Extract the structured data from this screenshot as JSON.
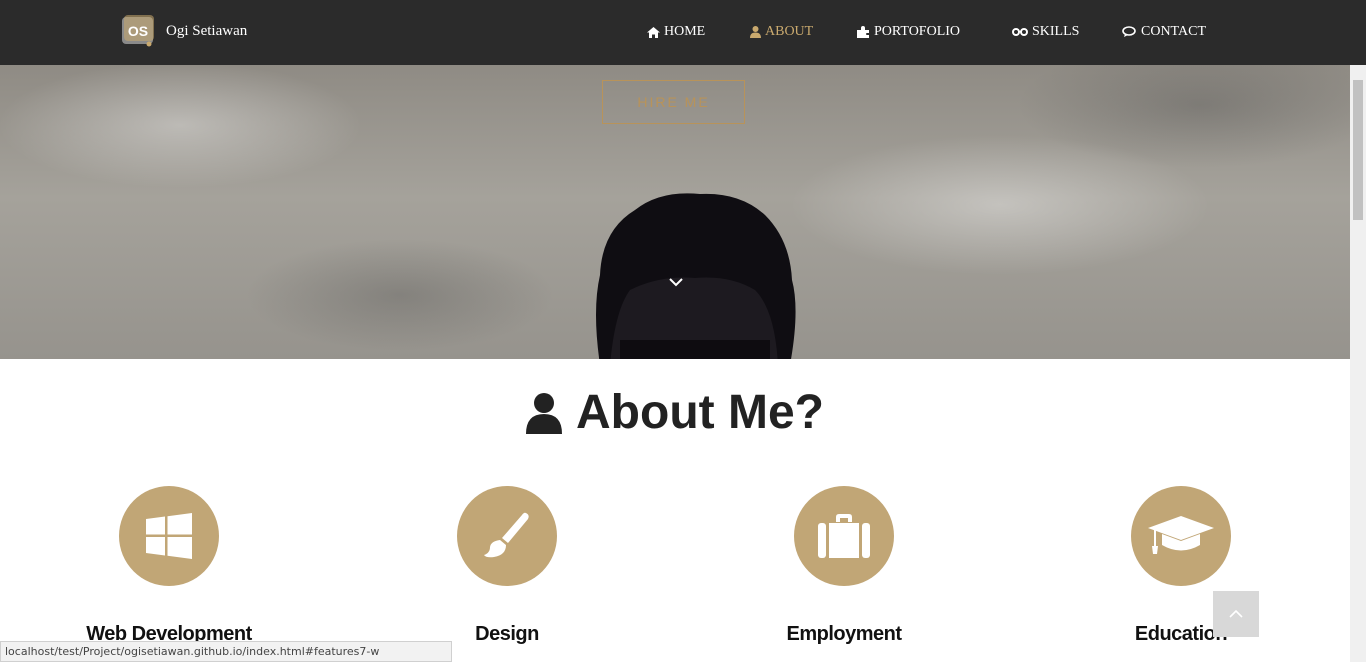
{
  "brand": {
    "name": "Ogi Setiawan",
    "logo_text": "OS"
  },
  "nav": {
    "items": [
      {
        "label": "HOME",
        "icon": "home-icon",
        "active": false
      },
      {
        "label": "ABOUT",
        "icon": "user-icon",
        "active": true
      },
      {
        "label": "PORTOFOLIO",
        "icon": "puzzle-icon",
        "active": false
      },
      {
        "label": "SKILLS",
        "icon": "glasses-icon",
        "active": false
      },
      {
        "label": "CONTACT",
        "icon": "chat-icon",
        "active": false
      }
    ]
  },
  "hero": {
    "button_label": "HIRE ME",
    "scroll_icon": "chevron-down-icon"
  },
  "about": {
    "title": "About Me?",
    "title_icon": "user-icon",
    "features": [
      {
        "label": "Web Development",
        "icon": "windows-icon"
      },
      {
        "label": "Design",
        "icon": "paintbrush-icon"
      },
      {
        "label": "Employment",
        "icon": "briefcase-icon"
      },
      {
        "label": "Education",
        "icon": "graduation-cap-icon"
      }
    ]
  },
  "back_to_top": {
    "icon": "chevron-up-icon"
  },
  "status_bar": {
    "url": "localhost/test/Project/ogisetiawan.github.io/index.html#features7-w"
  },
  "colors": {
    "accent": "#c1a676",
    "nav_bg": "#2b2b2b",
    "active_nav": "#c9a96e"
  }
}
